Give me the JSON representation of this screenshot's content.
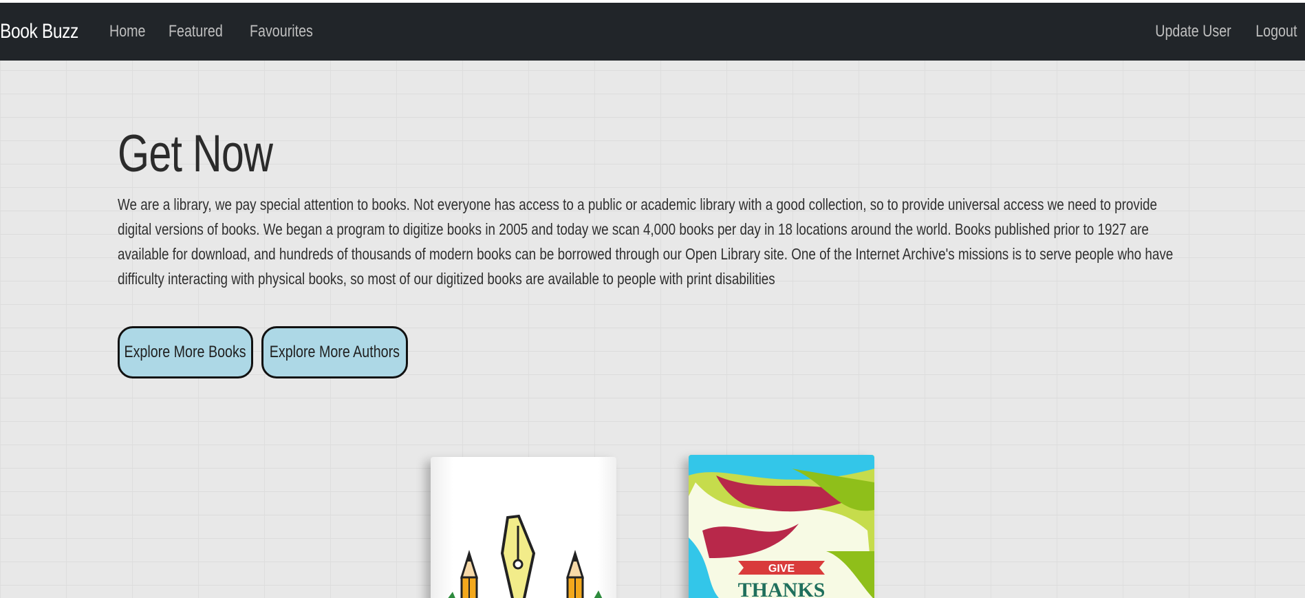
{
  "navbar": {
    "brand": "Book Buzz",
    "links": [
      "Home",
      "Featured",
      "Favourites"
    ],
    "right_links": [
      "Update User",
      "Logout"
    ]
  },
  "hero": {
    "title": "Get Now",
    "text": "We are a library, we pay special attention to books. Not everyone has access to a public or academic library with a good collection, so to provide universal access we need to provide digital versions of books. We began a program to digitize books in 2005 and today we scan 4,000 books per day in 18 locations around the world. Books published prior to 1927 are available for download, and hundreds of thousands of modern books can be borrowed through our Open Library site. One of the Internet Archive's missions is to serve people who have difficulty interacting with physical books, so most of our digitized books are available to people with print disabilities"
  },
  "buttons": {
    "books": "Explore More Books",
    "authors": "Explore More Authors"
  },
  "books": {
    "book2_cover_top": "GIVE",
    "book2_cover_main": "THANKS"
  },
  "colors": {
    "navbar_bg": "#212529",
    "button_bg": "#add8e6",
    "page_bg": "#e8e8e8"
  }
}
